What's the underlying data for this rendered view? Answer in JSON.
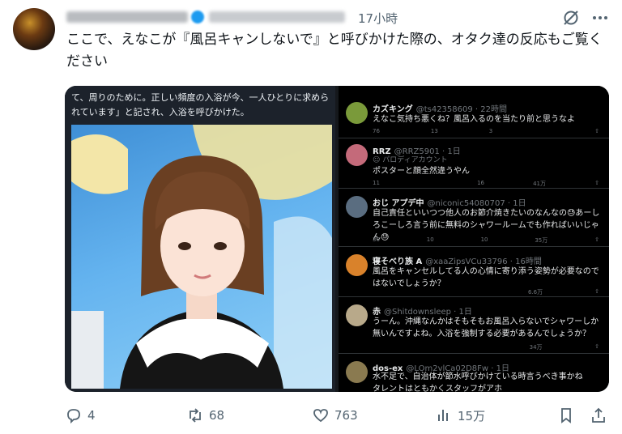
{
  "header": {
    "posted_time": "17小時",
    "grok_icon": "grok-slash-icon",
    "more_icon": "more-horizontal-icon"
  },
  "tweet": {
    "text": "ここで、えなこが『風呂キャンしないで』と呼びかけた際の、オタク達の反応もご覧ください"
  },
  "media": {
    "article_text": "て、周りのために。正しい頻度の入浴が今、一人ひとりに求められています」と記され、入浴を呼びかけた。",
    "replies": [
      {
        "name": "カズキング",
        "handle": "@ts42358609 · 22時間",
        "tag": "",
        "text": "えなこ気持ち悪くね？風呂入るのを当たり前と思うなよ",
        "stats": [
          "76",
          "13",
          "3",
          "",
          ""
        ],
        "avatar_color": "#7a9a3a"
      },
      {
        "name": "RRZ",
        "handle": "@RRZ5901 · 1日",
        "tag": "パロディアカウント",
        "text": "ポスターと顔全然違うやん",
        "stats": [
          "11",
          "",
          "16",
          "41万",
          ""
        ],
        "avatar_color": "#c46a7a"
      },
      {
        "name": "おじ アプデ中",
        "handle": "@niconic54080707 · 1日",
        "tag": "",
        "text": "自己責任といいつつ他人のお節介焼きたいのなんなの😓あーしろこーしろ言う前に無料のシャワールームでも作ればいいじゃん😓",
        "stats": [
          "30",
          "10",
          "10",
          "35万",
          ""
        ],
        "avatar_color": "#5a6d80"
      },
      {
        "name": "寝そべり族 A",
        "handle": "@xaaZipsVCu33796 · 16時間",
        "tag": "",
        "text": "風呂をキャンセルしてる人の心情に寄り添う姿勢が必要なのではないでしょうか？",
        "stats": [
          "",
          "",
          "",
          "6.6万",
          ""
        ],
        "avatar_color": "#d9822b"
      },
      {
        "name": "赤",
        "handle": "@Shitdownsleep · 1日",
        "tag": "",
        "text": "うーん。沖縄なんかはそもそもお風呂入らないでシャワーしか無いんですよね。入浴を強制する必要があるんでしょうか？",
        "stats": [
          "",
          "",
          "",
          "34万",
          ""
        ],
        "avatar_color": "#b8a98a"
      },
      {
        "name": "dos-ex",
        "handle": "@LOm2vlCa02D8Fw · 1日",
        "tag": "",
        "text": "水不足で、自治体が節水呼びかけている時言うべき事かね\nタレントはともかくスタッフがアホ",
        "stats": [
          "",
          "",
          "",
          "",
          ""
        ],
        "avatar_color": "#8a7a50"
      }
    ]
  },
  "actions": {
    "reply_count": "4",
    "retweet_count": "68",
    "like_count": "763",
    "view_count": "15万"
  }
}
